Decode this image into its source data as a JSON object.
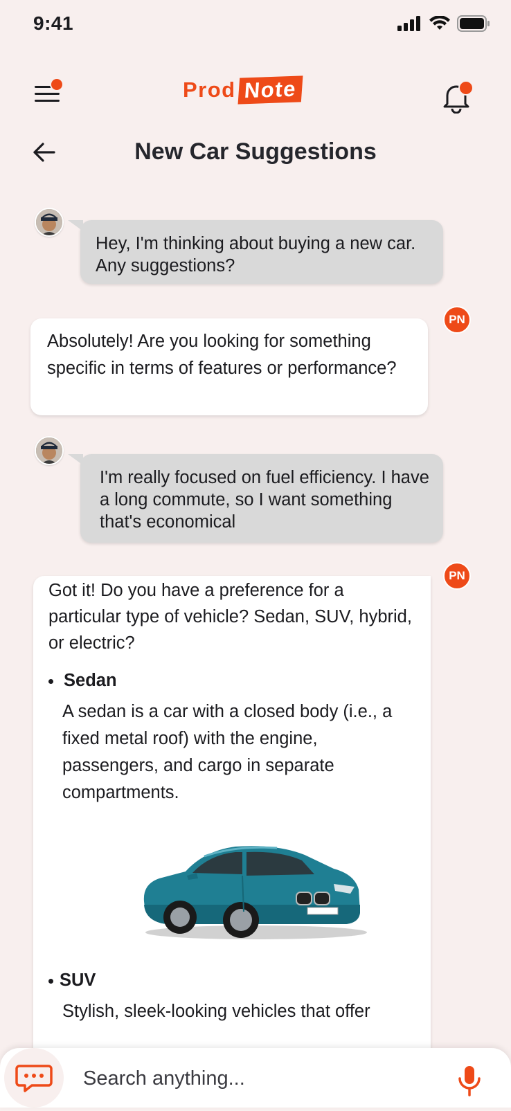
{
  "status_bar": {
    "time": "9:41"
  },
  "header": {
    "logo_prod": "Prod",
    "logo_note": "Note",
    "title": "New Car Suggestions"
  },
  "messages": [
    {
      "from": "user",
      "text": "Hey, I'm thinking about buying a new car. Any suggestions?"
    },
    {
      "from": "assistant",
      "badge": "PN",
      "text": "Absolutely! Are you looking for something specific in terms of features or performance?"
    },
    {
      "from": "user",
      "text": "I'm really focused on fuel efficiency. I have a long commute, so I want something that's economical"
    },
    {
      "from": "assistant",
      "badge": "PN",
      "text": "Got it! Do you have a preference for a particular type of vehicle? Sedan, SUV, hybrid, or electric?",
      "items": [
        {
          "title": "Sedan",
          "description": "A sedan  is a car with a closed body (i.e., a fixed metal roof) with the engine, passengers, and cargo in separate compartments.",
          "image": "teal-sedan-car-image"
        },
        {
          "title": "SUV",
          "description": "Stylish, sleek-looking vehicles that offer"
        }
      ]
    }
  ],
  "search": {
    "placeholder": "Search anything..."
  },
  "colors": {
    "accent": "#ee4a18",
    "background": "#f8efee",
    "user_bubble": "#d9d9d9",
    "ai_bubble": "#ffffff"
  }
}
